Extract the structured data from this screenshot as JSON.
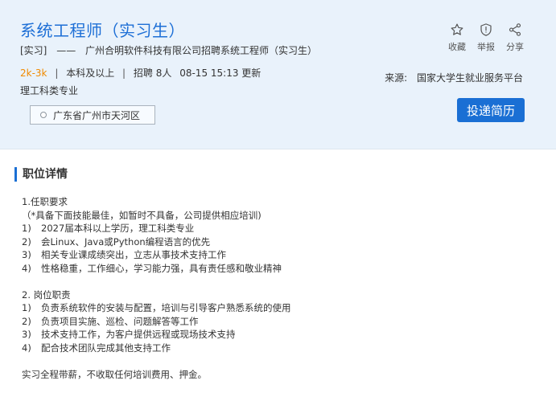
{
  "job": {
    "title": "系统工程师（实习生）",
    "type_tag": "[实习]",
    "dash": "——",
    "company_headline": "广州合明软件科技有限公司招聘系统工程师（实习生）",
    "salary": "2k-3k",
    "education": "本科及以上",
    "headcount": "招聘 8人",
    "updated": "08-15 15:13 更新",
    "major": "理工科类专业",
    "location": "广东省广州市天河区"
  },
  "actions": {
    "favorite": "收藏",
    "report": "举报",
    "share": "分享"
  },
  "source": {
    "label": "来源:",
    "value": "国家大学生就业服务平台"
  },
  "apply_button": "投递简历",
  "section": {
    "title": "职位详情"
  },
  "details": {
    "req_heading": "1.任职要求",
    "req_note": "（*具备下面技能最佳，如暂时不具备，公司提供相应培训)",
    "requirements": [
      {
        "num": "1)",
        "text": "2027届本科以上学历，理工科类专业"
      },
      {
        "num": "2)",
        "text": "会Linux、Java或Python编程语言的优先"
      },
      {
        "num": "3)",
        "text": "相关专业课成绩突出，立志从事技术支持工作"
      },
      {
        "num": "4)",
        "text": "性格稳重，工作细心，学习能力强，具有责任感和敬业精神"
      }
    ],
    "duty_heading": "2. 岗位职责",
    "duties": [
      {
        "num": "1)",
        "text": "负责系统软件的安装与配置，培训与引导客户熟悉系统的使用"
      },
      {
        "num": "2)",
        "text": "负责项目实施、巡检、问题解答等工作"
      },
      {
        "num": "3)",
        "text": "技术支持工作，为客户提供远程或现场技术支持"
      },
      {
        "num": "4)",
        "text": "配合技术团队完成其他支持工作"
      }
    ],
    "footer_note": "实习全程带薪，不收取任何培训费用、押金。"
  },
  "colors": {
    "accent": "#1a6fd4",
    "salary": "#f08a00",
    "header_bg": "#e9f2fb"
  },
  "icons": [
    "star-icon",
    "shield-icon",
    "share-icon"
  ]
}
